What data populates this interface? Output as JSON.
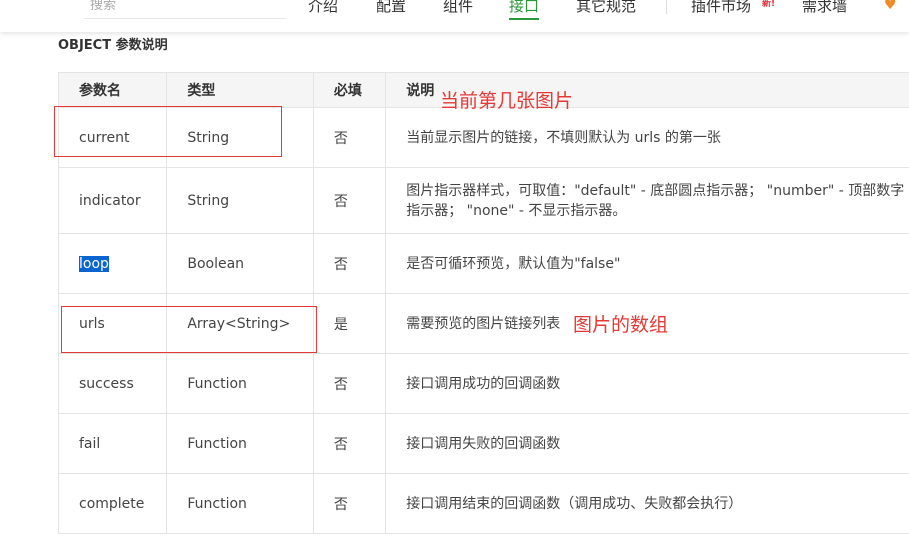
{
  "nav": {
    "search_placeholder": "搜索",
    "items": [
      {
        "label": "介绍"
      },
      {
        "label": "配置"
      },
      {
        "label": "组件"
      },
      {
        "label": "接口"
      },
      {
        "label": "其它规范"
      },
      {
        "label": "插件市场"
      },
      {
        "label": "需求墙"
      }
    ],
    "new_badge": "新!",
    "accent": "#2b9939"
  },
  "section_title": "OBJECT 参数说明",
  "table": {
    "headers": [
      "参数名",
      "类型",
      "必填",
      "说明"
    ],
    "rows": [
      {
        "name": "current",
        "type": "String",
        "required": "否",
        "desc": "当前显示图片的链接，不填则默认为 urls 的第一张"
      },
      {
        "name": "indicator",
        "type": "String",
        "required": "否",
        "desc": "图片指示器样式，可取值：\"default\" - 底部圆点指示器； \"number\" - 顶部数字指示器； \"none\" - 不显示指示器。"
      },
      {
        "name": "loop",
        "type": "Boolean",
        "required": "否",
        "desc": "是否可循环预览，默认值为\"false\""
      },
      {
        "name": "urls",
        "type": "Array<String>",
        "required": "是",
        "desc": "需要预览的图片链接列表"
      },
      {
        "name": "success",
        "type": "Function",
        "required": "否",
        "desc": "接口调用成功的回调函数"
      },
      {
        "name": "fail",
        "type": "Function",
        "required": "否",
        "desc": "接口调用失败的回调函数"
      },
      {
        "name": "complete",
        "type": "Function",
        "required": "否",
        "desc": "接口调用结束的回调函数（调用成功、失败都会执行）"
      }
    ]
  },
  "annotations": {
    "current_note": "当前第几张图片",
    "urls_note": "图片的数组",
    "color": "#e53935"
  },
  "selection_color": "#0a64d0"
}
